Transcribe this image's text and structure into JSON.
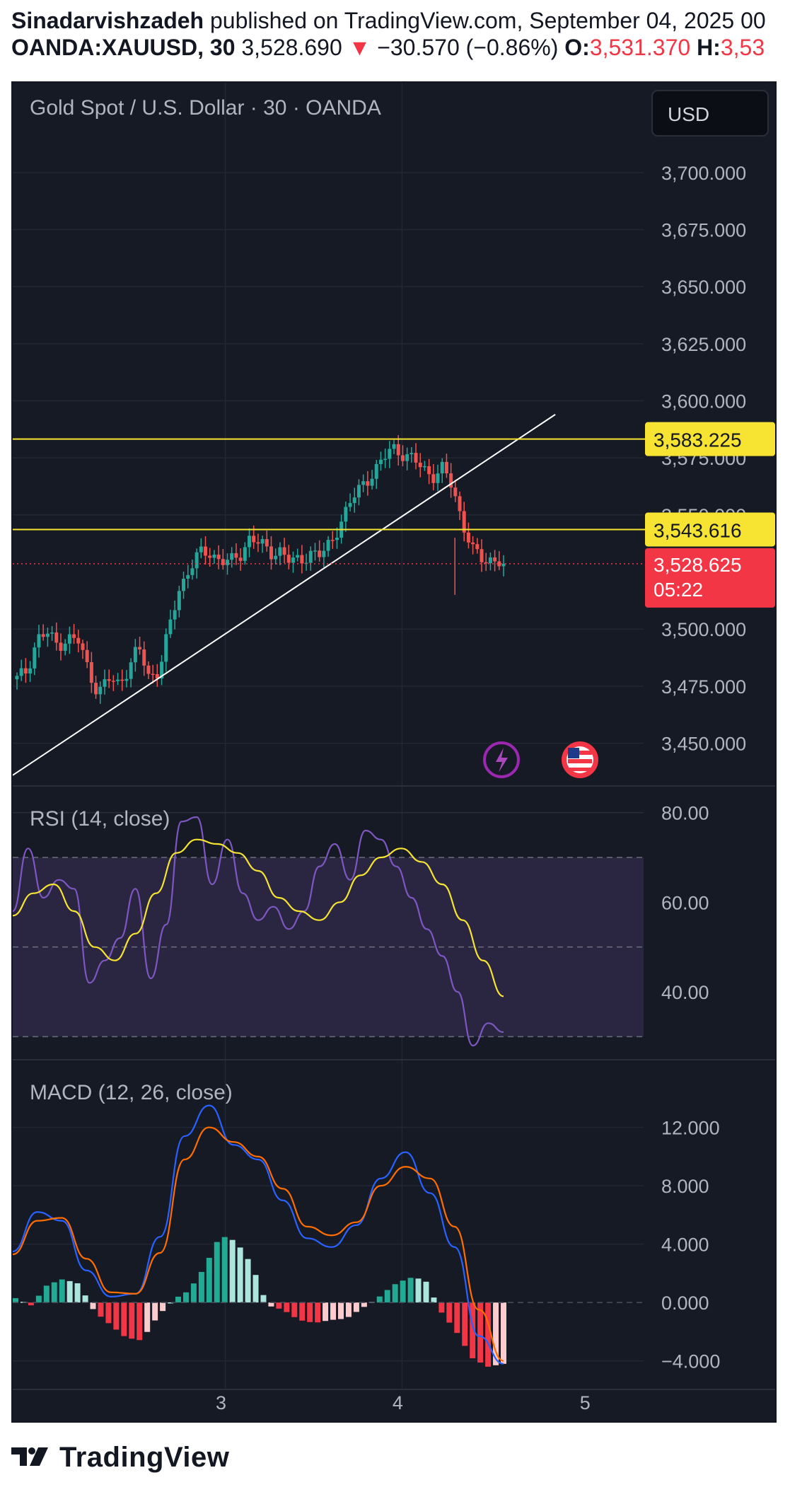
{
  "header": {
    "author": "Sinadarvishzadeh",
    "published": "published on TradingView.com, September 04, 2025 00",
    "symbol": "OANDA:XAUUSD, 30",
    "last": "3,528.690",
    "arrow": "▼",
    "change": "−30.570 (−0.86%)",
    "o_label": "O:",
    "o_value": "3,531.370",
    "h_label": "H:",
    "h_value": "3,53"
  },
  "chart": {
    "title": "Gold Spot / U.S. Dollar · 30 · OANDA",
    "currency_button": "USD",
    "x_ticks": [
      "3",
      "4",
      "5"
    ],
    "colors": {
      "up": "#26a69a",
      "down": "#ef5350",
      "level": "#f7e432",
      "rsi": "#7e57c2",
      "rsi_ma": "#f7e432",
      "macd": "#2962ff",
      "signal": "#ff6d00"
    }
  },
  "chart_data": [
    {
      "type": "candlestick",
      "title": "Gold Spot / U.S. Dollar · 30 · OANDA",
      "y_ticks": [
        "3,700.000",
        "3,675.000",
        "3,650.000",
        "3,625.000",
        "3,600.000",
        "3,575.000",
        "3,550.000",
        "3,500.000",
        "3,475.000",
        "3,450.000"
      ],
      "ylim": [
        3435,
        3730
      ],
      "x_ticks": [
        "3",
        "4",
        "5"
      ],
      "close_path": [
        3478,
        3482,
        3496,
        3498,
        3493,
        3496,
        3495,
        3483,
        3472,
        3478,
        3476,
        3483,
        3492,
        3479,
        3482,
        3500,
        3517,
        3527,
        3533,
        3533,
        3531,
        3529,
        3532,
        3541,
        3537,
        3533,
        3535,
        3529,
        3530,
        3534,
        3532,
        3538,
        3548,
        3556,
        3563,
        3568,
        3573,
        3580,
        3577,
        3574,
        3571,
        3567,
        3570,
        3562,
        3546,
        3534,
        3530,
        3531,
        3528.625
      ],
      "trendline": {
        "from": [
          0,
          3436
        ],
        "to": [
          0.86,
          3594
        ]
      },
      "levels": [
        {
          "value": 3583.225,
          "label": "3,583.225"
        },
        {
          "value": 3543.616,
          "label": "3,543.616"
        }
      ],
      "current_price": {
        "label": "3,528.625",
        "countdown": "05:22"
      },
      "event_icons": [
        "lightning-icon",
        "us-flag-icon"
      ]
    },
    {
      "type": "line",
      "title": "RSI (14, close)",
      "y_ticks": [
        "80.00",
        "60.00",
        "40.00"
      ],
      "ylim": [
        25,
        85
      ],
      "bands": [
        30,
        50,
        70
      ],
      "series": [
        {
          "name": "RSI",
          "values": [
            58,
            72,
            61,
            65,
            63,
            42,
            47,
            52,
            63,
            43,
            55,
            78,
            79,
            64,
            74,
            62,
            56,
            59,
            54,
            58,
            68,
            73,
            65,
            76,
            74,
            68,
            61,
            54,
            48,
            40,
            28,
            33,
            31
          ]
        },
        {
          "name": "RSI MA",
          "values": [
            57,
            62,
            64,
            58,
            50,
            47,
            53,
            62,
            71,
            74,
            73,
            71,
            67,
            61,
            58,
            56,
            60,
            66,
            70,
            72,
            69,
            64,
            56,
            47,
            39
          ]
        }
      ]
    },
    {
      "type": "line",
      "title": "MACD (12, 26, close)",
      "y_ticks": [
        "12.000",
        "8.000",
        "4.000",
        "0.000",
        "−4.000"
      ],
      "ylim": [
        -4.5,
        14.5
      ],
      "series": [
        {
          "name": "MACD",
          "values": [
            3.5,
            6.2,
            5.6,
            2.2,
            0.4,
            0.6,
            4.5,
            11.4,
            13.5,
            10.8,
            9.8,
            7.0,
            4.4,
            3.8,
            5.3,
            8.5,
            10.3,
            7.5,
            3.8,
            -2.3,
            -4.2
          ]
        },
        {
          "name": "Signal",
          "values": [
            3.3,
            5.6,
            5.8,
            3.0,
            0.7,
            0.6,
            3.4,
            9.8,
            12.0,
            11.0,
            10.0,
            7.8,
            5.2,
            4.6,
            5.5,
            8.0,
            9.3,
            8.5,
            5.2,
            -0.5,
            -4.0
          ]
        }
      ],
      "histogram": [
        0.3,
        -0.2,
        1.2,
        1.6,
        1.3,
        -0.6,
        -1.5,
        -2.4,
        -2.6,
        -1.0,
        0.2,
        0.8,
        2.4,
        4.6,
        4.2,
        2.6,
        -0.2,
        -0.5,
        -1.2,
        -1.4,
        -1.2,
        -1.1,
        -0.4,
        0.3,
        1.2,
        1.7,
        1.6,
        -0.6,
        -2.0,
        -3.8,
        -4.4,
        -4.2
      ]
    }
  ],
  "footer": {
    "brand": "TradingView"
  }
}
